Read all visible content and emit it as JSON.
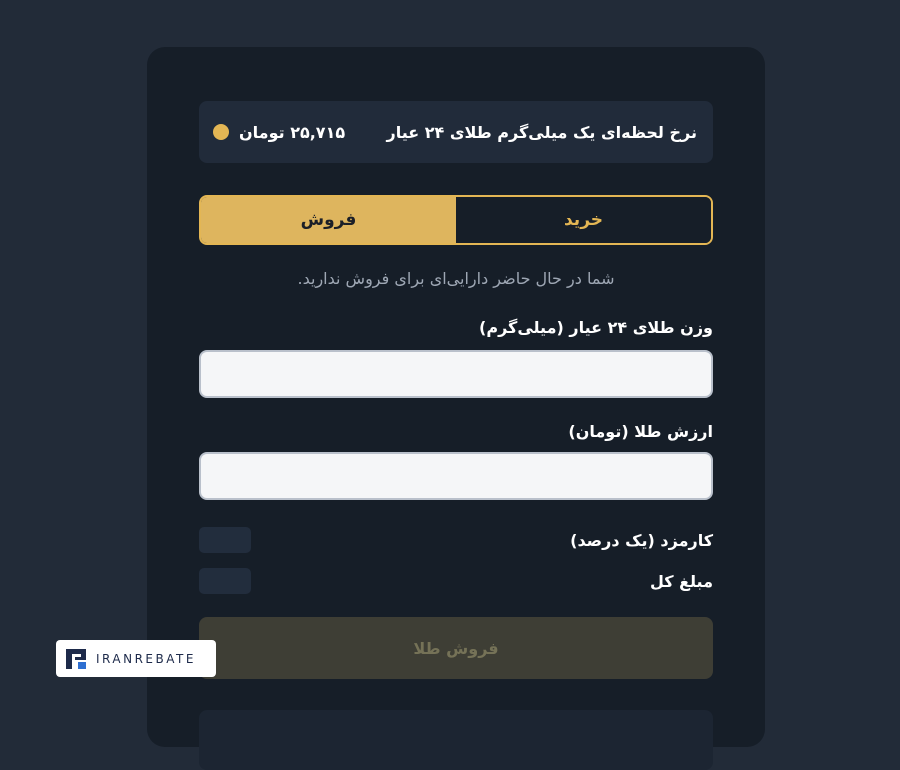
{
  "rate": {
    "label": "نرخ لحظه‌ای یک میلی‌گرم طلای ۲۴ عیار",
    "value": "۲۵,۷۱۵ تومان",
    "indicator_color": "#e3b654"
  },
  "tabs": {
    "buy_label": "خرید",
    "sell_label": "فروش",
    "active": "sell"
  },
  "notice": "شما در حال حاضر دارایی‌ای برای فروش ندارید.",
  "form": {
    "weight_label": "وزن طلای ۲۴ عیار (میلی‌گرم)",
    "weight_value": "",
    "value_label": "ارزش طلا (تومان)",
    "value_value": ""
  },
  "summary": {
    "fee_label": "کارمزد (یک درصد)",
    "total_label": "مبلغ کل"
  },
  "submit_label": "فروش طلا",
  "watermark": {
    "brand": "IRANREBATE"
  },
  "colors": {
    "accent": "#e3b654",
    "background": "#222b38",
    "card": "#161e28"
  }
}
